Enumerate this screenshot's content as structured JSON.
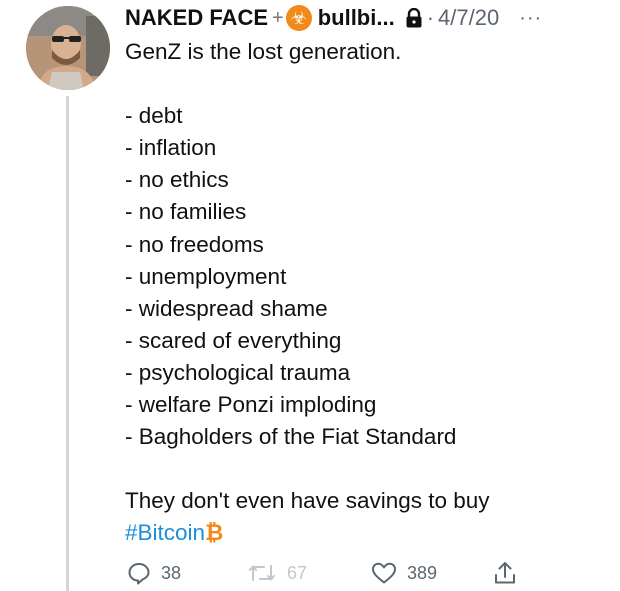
{
  "author": {
    "display_name": "NAKED FACE",
    "cross_glyph": "+",
    "badge_glyph": "☣",
    "handle": "bullbi...",
    "separator": "·",
    "date": "4/7/20",
    "more_glyph": "···"
  },
  "tweet": {
    "intro": "GenZ is the lost generation.",
    "items": [
      "- debt",
      "- inflation",
      "- no ethics",
      "- no families",
      "- no freedoms",
      "- unemployment",
      "- widespread shame",
      "- scared of everything",
      "- psychological trauma",
      "- welfare Ponzi imploding",
      "- Bagholders of the Fiat Standard"
    ],
    "outro": "They don't even have savings to buy",
    "hashtag": "#Bitcoin",
    "btc_glyph": "₿"
  },
  "actions": {
    "reply_count": "38",
    "retweet_count": "67",
    "like_count": "389"
  },
  "colors": {
    "link": "#1d8ed8",
    "bitcoin": "#f28a19",
    "muted": "#5b6670"
  }
}
